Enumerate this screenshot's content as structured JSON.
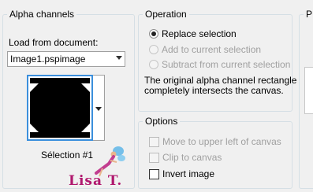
{
  "alpha_group": {
    "title": "Alpha channels",
    "load_from_label": "Load from document:",
    "document_value": "Image1.pspimage",
    "selection_name": "Sélection #1"
  },
  "operation_group": {
    "title": "Operation",
    "options": [
      {
        "label": "Replace selection",
        "selected": true,
        "enabled": true
      },
      {
        "label": "Add to current selection",
        "selected": false,
        "enabled": false
      },
      {
        "label": "Subtract from current selection",
        "selected": false,
        "enabled": false
      }
    ],
    "description": "The original alpha channel rectangle completely intersects the canvas."
  },
  "options_group": {
    "title": "Options",
    "items": [
      {
        "label": "Move to upper left of canvas",
        "checked": false,
        "enabled": false
      },
      {
        "label": "Clip to canvas",
        "checked": false,
        "enabled": false
      },
      {
        "label": "Invert image",
        "checked": false,
        "enabled": true
      }
    ]
  },
  "third_group": {
    "title": "P"
  },
  "watermark": {
    "text": "Lisa T."
  },
  "icons": {
    "preview_dropdown": "chevron-down-icon",
    "watermark_figure": "fairy-figure-icon"
  },
  "colors": {
    "panel": "#f0f0f0",
    "group_border": "#d5dfe5",
    "preview_border": "#3b8fdc",
    "watermark_text": "#b0186e"
  }
}
